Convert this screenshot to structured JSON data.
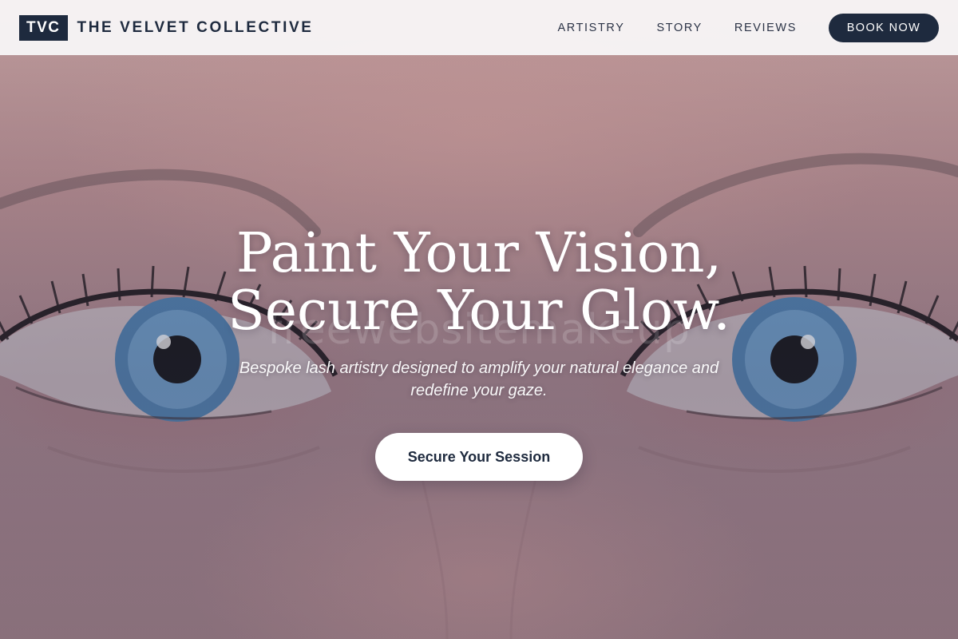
{
  "header": {
    "brand_mark": "TVC",
    "brand_name": "THE VELVET COLLECTIVE",
    "nav": [
      {
        "label": "ARTISTRY"
      },
      {
        "label": "STORY"
      },
      {
        "label": "REVIEWS"
      }
    ],
    "book_label": "BOOK NOW"
  },
  "hero": {
    "title_line1": "Paint Your Vision,",
    "title_line2": "Secure Your Glow.",
    "subtitle": "Bespoke lash artistry designed to amplify your natural elegance and redefine your gaze.",
    "cta_label": "Secure Your Session",
    "watermark": "freewebsitemakeup",
    "background_image": "close-up-face-blue-eyes-lashes"
  },
  "colors": {
    "brand_navy": "#1e2a3e",
    "header_bg": "#f7f5f6",
    "hero_text": "#ffffff",
    "cta_bg": "#ffffff"
  }
}
